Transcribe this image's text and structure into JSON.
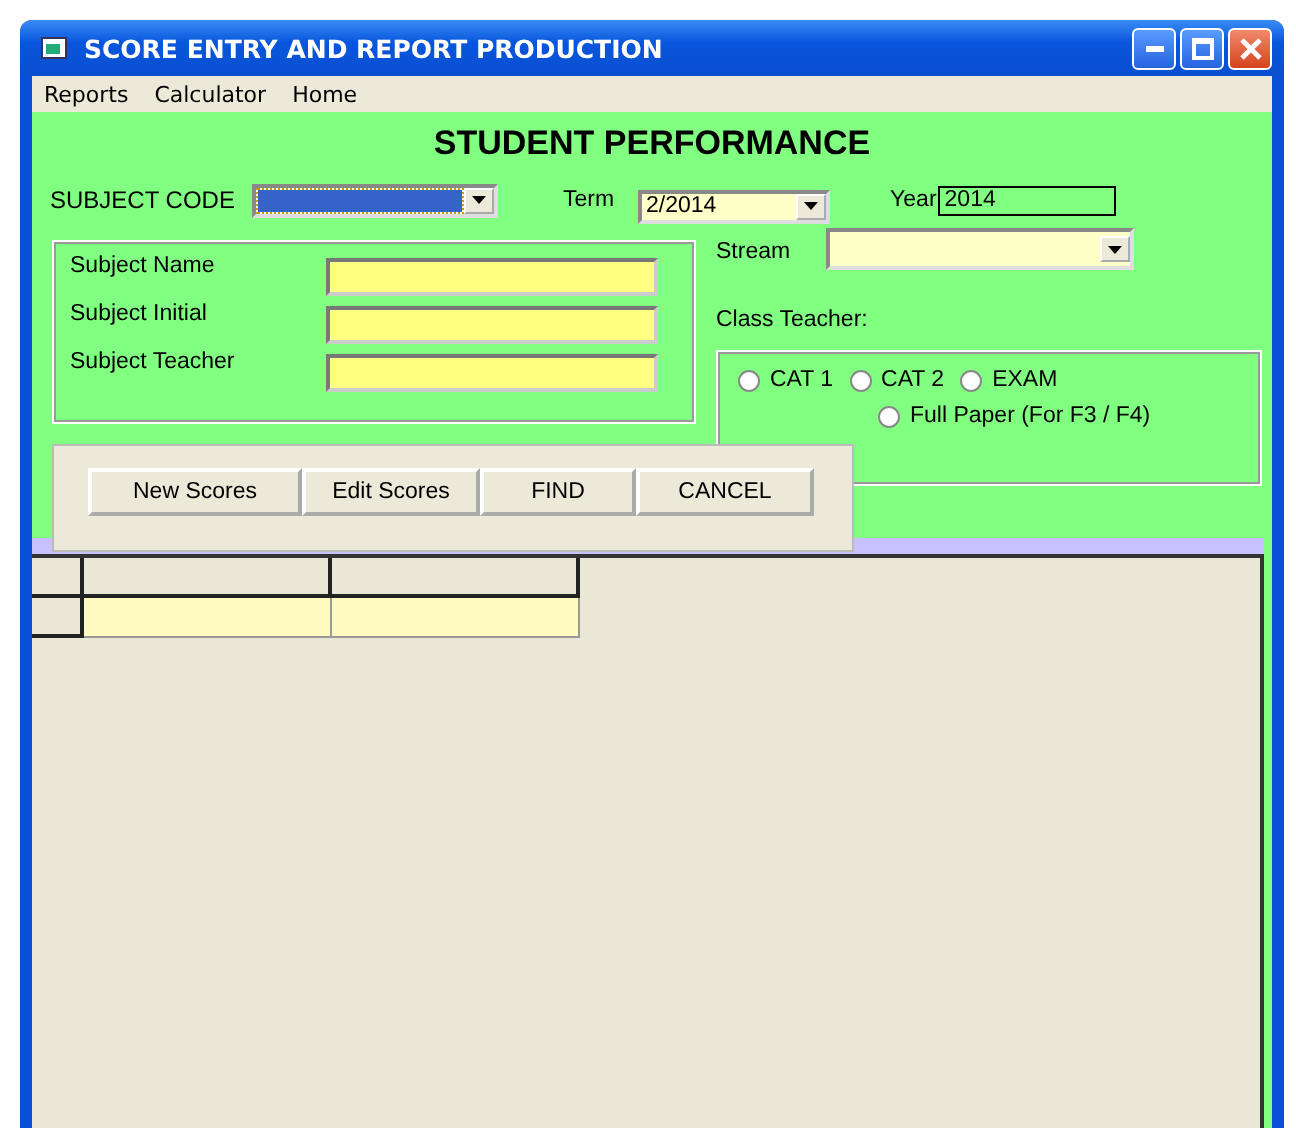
{
  "window": {
    "title": "SCORE ENTRY AND REPORT PRODUCTION"
  },
  "menu": [
    "Reports",
    "Calculator",
    "Home"
  ],
  "heading": "STUDENT PERFORMANCE",
  "subject_code": {
    "label": "SUBJECT CODE",
    "focused": true
  },
  "term": {
    "label": "Term",
    "value": "2/2014"
  },
  "year": {
    "label": "Year",
    "value": "2014"
  },
  "subject_fields": [
    {
      "label": "Subject Name"
    },
    {
      "label": "Subject Initial"
    },
    {
      "label": "Subject Teacher"
    }
  ],
  "stream": {
    "label": "Stream"
  },
  "class_teacher": {
    "label": "Class Teacher:"
  },
  "exam_options": [
    {
      "label": "CAT 1",
      "selected": false
    },
    {
      "label": "CAT 2",
      "selected": false
    },
    {
      "label": "EXAM",
      "selected": false
    },
    {
      "label": "Full Paper (For F3 / F4)",
      "selected": false
    }
  ],
  "buttons": [
    "New Scores",
    "Edit Scores",
    "FIND",
    "CANCEL"
  ]
}
